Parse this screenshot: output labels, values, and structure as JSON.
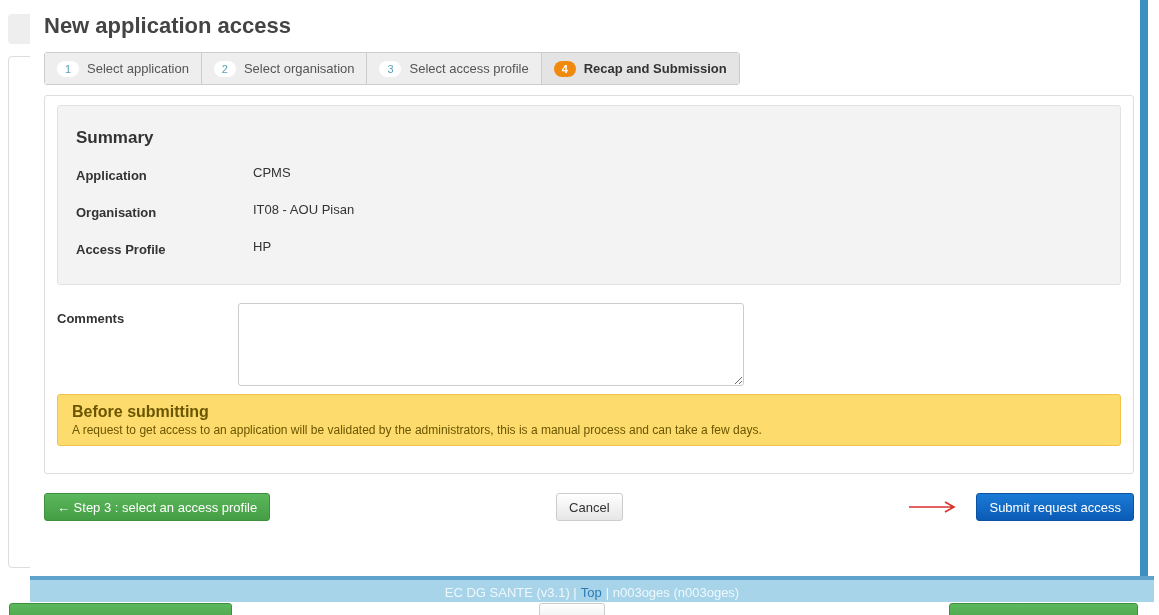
{
  "dialog": {
    "title": "New application access",
    "steps": [
      {
        "number": "1",
        "label": "Select application",
        "selected": false
      },
      {
        "number": "2",
        "label": "Select organisation",
        "selected": false
      },
      {
        "number": "3",
        "label": "Select access profile",
        "selected": false
      },
      {
        "number": "4",
        "label": "Recap and Submission",
        "selected": true
      }
    ],
    "summary": {
      "heading": "Summary",
      "rows": [
        {
          "label": "Application",
          "value": "CPMS"
        },
        {
          "label": "Organisation",
          "value": "IT08 - AOU Pisan"
        },
        {
          "label": "Access Profile",
          "value": "HP"
        }
      ]
    },
    "comments": {
      "label": "Comments"
    },
    "alert": {
      "title": "Before submitting",
      "text": "A request to get access to an application will be validated by the administrators, this is a manual process and can take a few days."
    },
    "buttons": [
      {
        "kind": "success",
        "label": "← Step 3 : select an access profile"
      },
      {
        "kind": "default",
        "label": "Cancel"
      },
      {
        "kind": "primary",
        "label": "Submit request access"
      }
    ]
  },
  "footer": {
    "prefix": "EC DG SANTE (v3.1) |",
    "link": "Top",
    "suffix": "| n003oges (n003oges)"
  },
  "background_buttons": [
    {
      "kind": "success"
    },
    {
      "kind": "default"
    },
    {
      "kind": "success"
    }
  ]
}
